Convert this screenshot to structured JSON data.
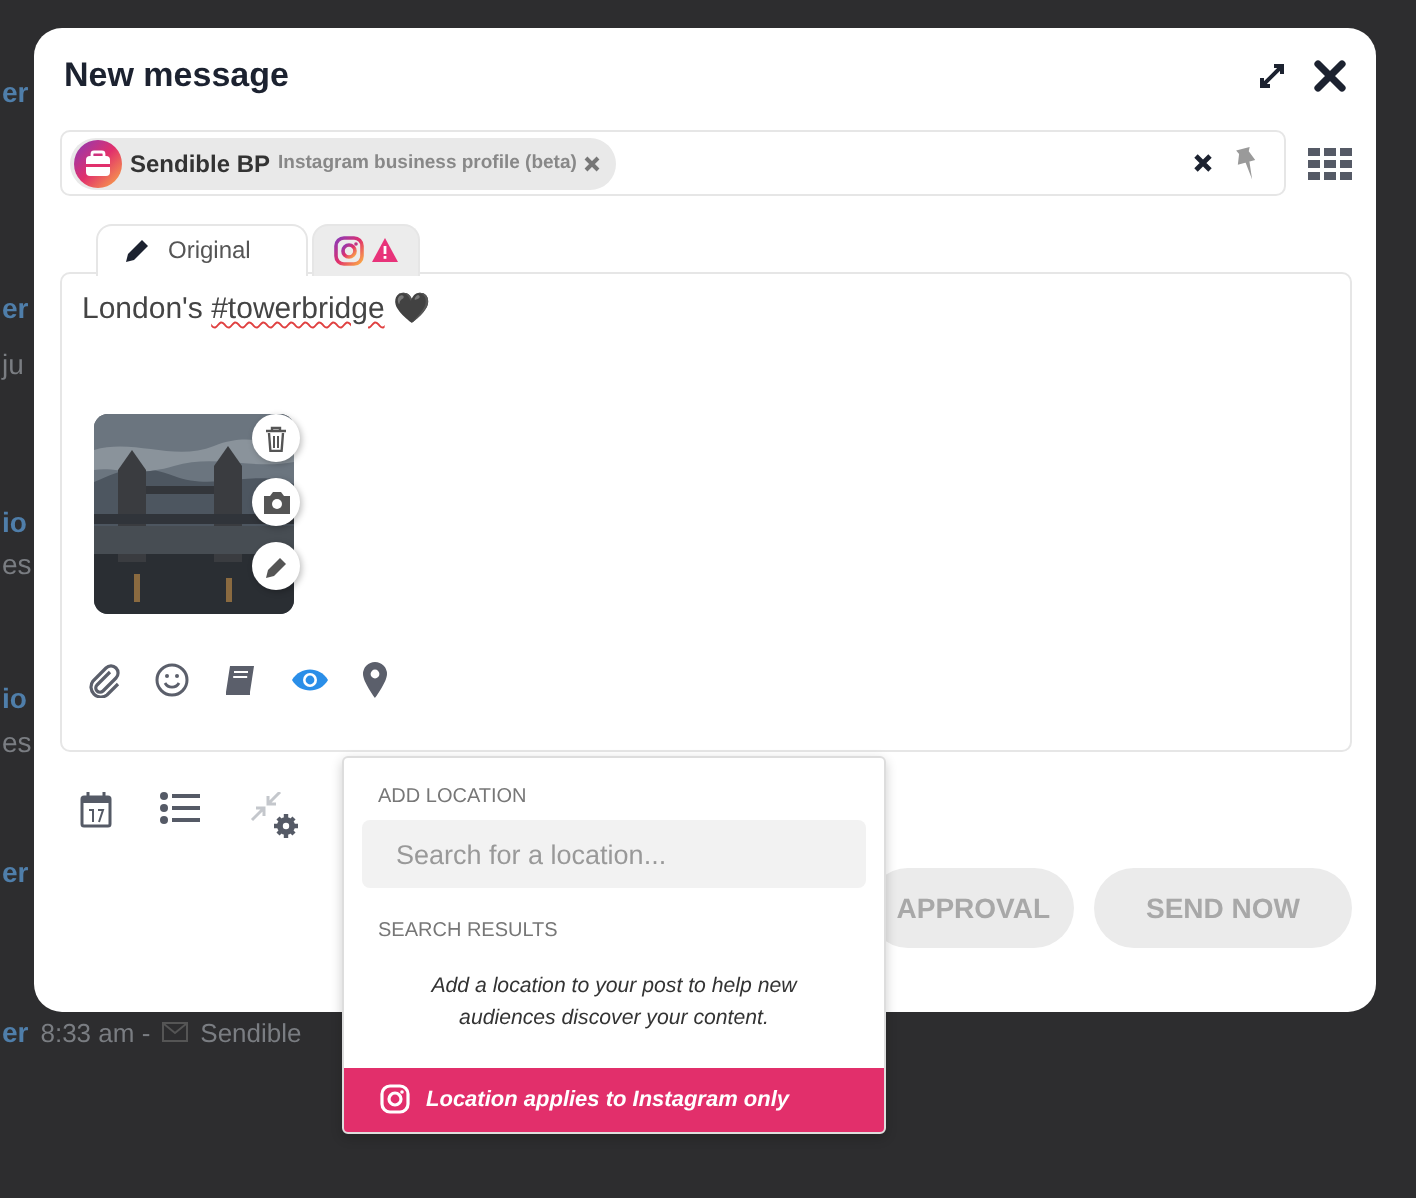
{
  "background_feed": [
    {
      "text": "er",
      "kind": "name"
    },
    {
      "text": "er",
      "kind": "name"
    },
    {
      "text": "ju",
      "kind": "body"
    },
    {
      "text": "io",
      "kind": "name"
    },
    {
      "text": "es",
      "kind": "body"
    },
    {
      "text": "io",
      "kind": "name"
    },
    {
      "text": "es",
      "kind": "body"
    },
    {
      "text": "er",
      "kind": "name"
    },
    {
      "text": "er",
      "kind": "name",
      "meta": "8:33 am -",
      "source": "Sendible"
    }
  ],
  "dialog": {
    "title": "New message",
    "recipient": {
      "name": "Sendible BP",
      "type": "Instagram business profile (beta)"
    },
    "tabs": [
      {
        "kind": "original",
        "label": "Original",
        "selected": true
      },
      {
        "kind": "instagram",
        "warning": true,
        "selected": false
      }
    ],
    "message": {
      "before": "London's ",
      "hashtag": "#towerbridge",
      "emoji": "🖤"
    },
    "toolbar": [
      {
        "kind": "attach",
        "active": false
      },
      {
        "kind": "emoji",
        "active": false
      },
      {
        "kind": "library",
        "active": false
      },
      {
        "kind": "preview",
        "active": true
      },
      {
        "kind": "location",
        "active": false
      }
    ],
    "buttons": [
      {
        "label": "APPROVAL",
        "disabled": true
      },
      {
        "label": "SEND NOW",
        "disabled": true
      }
    ]
  },
  "location_popover": {
    "heading": "ADD LOCATION",
    "search": {
      "placeholder": "Search for a location..."
    },
    "results_heading": "SEARCH RESULTS",
    "hint": "Add a location to your post to help new audiences discover your content.",
    "footer": "Location applies to Instagram only"
  }
}
